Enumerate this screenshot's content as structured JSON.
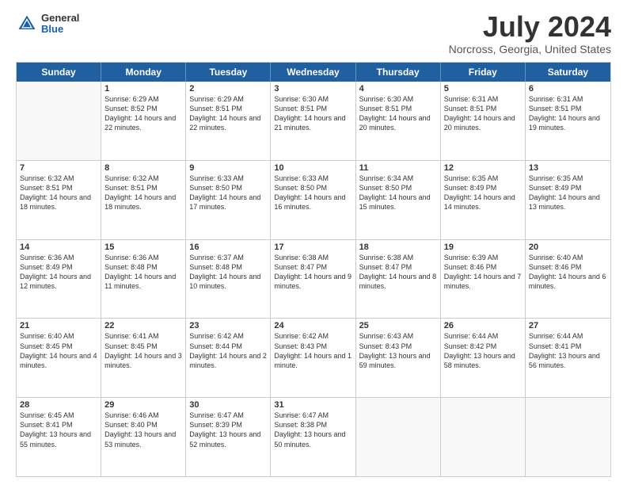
{
  "logo": {
    "general": "General",
    "blue": "Blue"
  },
  "header": {
    "title": "July 2024",
    "location": "Norcross, Georgia, United States"
  },
  "days_of_week": [
    "Sunday",
    "Monday",
    "Tuesday",
    "Wednesday",
    "Thursday",
    "Friday",
    "Saturday"
  ],
  "weeks": [
    [
      {
        "day": "",
        "empty": true
      },
      {
        "day": "1",
        "sunrise": "Sunrise: 6:29 AM",
        "sunset": "Sunset: 8:52 PM",
        "daylight": "Daylight: 14 hours and 22 minutes."
      },
      {
        "day": "2",
        "sunrise": "Sunrise: 6:29 AM",
        "sunset": "Sunset: 8:51 PM",
        "daylight": "Daylight: 14 hours and 22 minutes."
      },
      {
        "day": "3",
        "sunrise": "Sunrise: 6:30 AM",
        "sunset": "Sunset: 8:51 PM",
        "daylight": "Daylight: 14 hours and 21 minutes."
      },
      {
        "day": "4",
        "sunrise": "Sunrise: 6:30 AM",
        "sunset": "Sunset: 8:51 PM",
        "daylight": "Daylight: 14 hours and 20 minutes."
      },
      {
        "day": "5",
        "sunrise": "Sunrise: 6:31 AM",
        "sunset": "Sunset: 8:51 PM",
        "daylight": "Daylight: 14 hours and 20 minutes."
      },
      {
        "day": "6",
        "sunrise": "Sunrise: 6:31 AM",
        "sunset": "Sunset: 8:51 PM",
        "daylight": "Daylight: 14 hours and 19 minutes."
      }
    ],
    [
      {
        "day": "7",
        "sunrise": "Sunrise: 6:32 AM",
        "sunset": "Sunset: 8:51 PM",
        "daylight": "Daylight: 14 hours and 18 minutes."
      },
      {
        "day": "8",
        "sunrise": "Sunrise: 6:32 AM",
        "sunset": "Sunset: 8:51 PM",
        "daylight": "Daylight: 14 hours and 18 minutes."
      },
      {
        "day": "9",
        "sunrise": "Sunrise: 6:33 AM",
        "sunset": "Sunset: 8:50 PM",
        "daylight": "Daylight: 14 hours and 17 minutes."
      },
      {
        "day": "10",
        "sunrise": "Sunrise: 6:33 AM",
        "sunset": "Sunset: 8:50 PM",
        "daylight": "Daylight: 14 hours and 16 minutes."
      },
      {
        "day": "11",
        "sunrise": "Sunrise: 6:34 AM",
        "sunset": "Sunset: 8:50 PM",
        "daylight": "Daylight: 14 hours and 15 minutes."
      },
      {
        "day": "12",
        "sunrise": "Sunrise: 6:35 AM",
        "sunset": "Sunset: 8:49 PM",
        "daylight": "Daylight: 14 hours and 14 minutes."
      },
      {
        "day": "13",
        "sunrise": "Sunrise: 6:35 AM",
        "sunset": "Sunset: 8:49 PM",
        "daylight": "Daylight: 14 hours and 13 minutes."
      }
    ],
    [
      {
        "day": "14",
        "sunrise": "Sunrise: 6:36 AM",
        "sunset": "Sunset: 8:49 PM",
        "daylight": "Daylight: 14 hours and 12 minutes."
      },
      {
        "day": "15",
        "sunrise": "Sunrise: 6:36 AM",
        "sunset": "Sunset: 8:48 PM",
        "daylight": "Daylight: 14 hours and 11 minutes."
      },
      {
        "day": "16",
        "sunrise": "Sunrise: 6:37 AM",
        "sunset": "Sunset: 8:48 PM",
        "daylight": "Daylight: 14 hours and 10 minutes."
      },
      {
        "day": "17",
        "sunrise": "Sunrise: 6:38 AM",
        "sunset": "Sunset: 8:47 PM",
        "daylight": "Daylight: 14 hours and 9 minutes."
      },
      {
        "day": "18",
        "sunrise": "Sunrise: 6:38 AM",
        "sunset": "Sunset: 8:47 PM",
        "daylight": "Daylight: 14 hours and 8 minutes."
      },
      {
        "day": "19",
        "sunrise": "Sunrise: 6:39 AM",
        "sunset": "Sunset: 8:46 PM",
        "daylight": "Daylight: 14 hours and 7 minutes."
      },
      {
        "day": "20",
        "sunrise": "Sunrise: 6:40 AM",
        "sunset": "Sunset: 8:46 PM",
        "daylight": "Daylight: 14 hours and 6 minutes."
      }
    ],
    [
      {
        "day": "21",
        "sunrise": "Sunrise: 6:40 AM",
        "sunset": "Sunset: 8:45 PM",
        "daylight": "Daylight: 14 hours and 4 minutes."
      },
      {
        "day": "22",
        "sunrise": "Sunrise: 6:41 AM",
        "sunset": "Sunset: 8:45 PM",
        "daylight": "Daylight: 14 hours and 3 minutes."
      },
      {
        "day": "23",
        "sunrise": "Sunrise: 6:42 AM",
        "sunset": "Sunset: 8:44 PM",
        "daylight": "Daylight: 14 hours and 2 minutes."
      },
      {
        "day": "24",
        "sunrise": "Sunrise: 6:42 AM",
        "sunset": "Sunset: 8:43 PM",
        "daylight": "Daylight: 14 hours and 1 minute."
      },
      {
        "day": "25",
        "sunrise": "Sunrise: 6:43 AM",
        "sunset": "Sunset: 8:43 PM",
        "daylight": "Daylight: 13 hours and 59 minutes."
      },
      {
        "day": "26",
        "sunrise": "Sunrise: 6:44 AM",
        "sunset": "Sunset: 8:42 PM",
        "daylight": "Daylight: 13 hours and 58 minutes."
      },
      {
        "day": "27",
        "sunrise": "Sunrise: 6:44 AM",
        "sunset": "Sunset: 8:41 PM",
        "daylight": "Daylight: 13 hours and 56 minutes."
      }
    ],
    [
      {
        "day": "28",
        "sunrise": "Sunrise: 6:45 AM",
        "sunset": "Sunset: 8:41 PM",
        "daylight": "Daylight: 13 hours and 55 minutes."
      },
      {
        "day": "29",
        "sunrise": "Sunrise: 6:46 AM",
        "sunset": "Sunset: 8:40 PM",
        "daylight": "Daylight: 13 hours and 53 minutes."
      },
      {
        "day": "30",
        "sunrise": "Sunrise: 6:47 AM",
        "sunset": "Sunset: 8:39 PM",
        "daylight": "Daylight: 13 hours and 52 minutes."
      },
      {
        "day": "31",
        "sunrise": "Sunrise: 6:47 AM",
        "sunset": "Sunset: 8:38 PM",
        "daylight": "Daylight: 13 hours and 50 minutes."
      },
      {
        "day": "",
        "empty": true
      },
      {
        "day": "",
        "empty": true
      },
      {
        "day": "",
        "empty": true
      }
    ]
  ]
}
